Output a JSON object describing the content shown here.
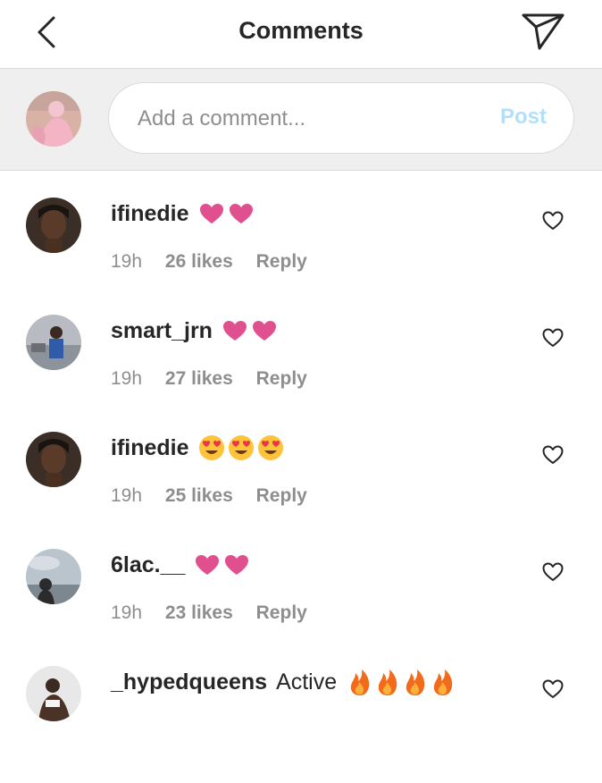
{
  "header": {
    "title": "Comments",
    "back_icon": "chevron-left-icon",
    "send_icon": "paper-plane-icon"
  },
  "composer": {
    "placeholder": "Add a comment...",
    "value": "",
    "post_label": "Post",
    "post_color": "#b2dffc"
  },
  "comments": [
    {
      "username": "ifinedie",
      "text": "",
      "emojis": [
        "pink-heart",
        "pink-heart"
      ],
      "time": "19h",
      "likes": "26 likes",
      "reply": "Reply"
    },
    {
      "username": "smart_jrn",
      "text": "",
      "emojis": [
        "pink-heart",
        "pink-heart"
      ],
      "time": "19h",
      "likes": "27 likes",
      "reply": "Reply"
    },
    {
      "username": "ifinedie",
      "text": "",
      "emojis": [
        "heart-eyes",
        "heart-eyes",
        "heart-eyes"
      ],
      "time": "19h",
      "likes": "25 likes",
      "reply": "Reply"
    },
    {
      "username": "6lac.__",
      "text": "",
      "emojis": [
        "pink-heart",
        "pink-heart"
      ],
      "time": "19h",
      "likes": "23 likes",
      "reply": "Reply"
    },
    {
      "username": "_hypedqueens",
      "text": "Active",
      "emojis": [
        "fire",
        "fire",
        "fire",
        "fire"
      ],
      "time": "",
      "likes": "",
      "reply": ""
    }
  ],
  "colors": {
    "heart_emoji": "#e0508f",
    "meta": "#8e8e8e",
    "text": "#262626",
    "divider": "#dbdbdb",
    "composer_bg": "#efefef"
  }
}
